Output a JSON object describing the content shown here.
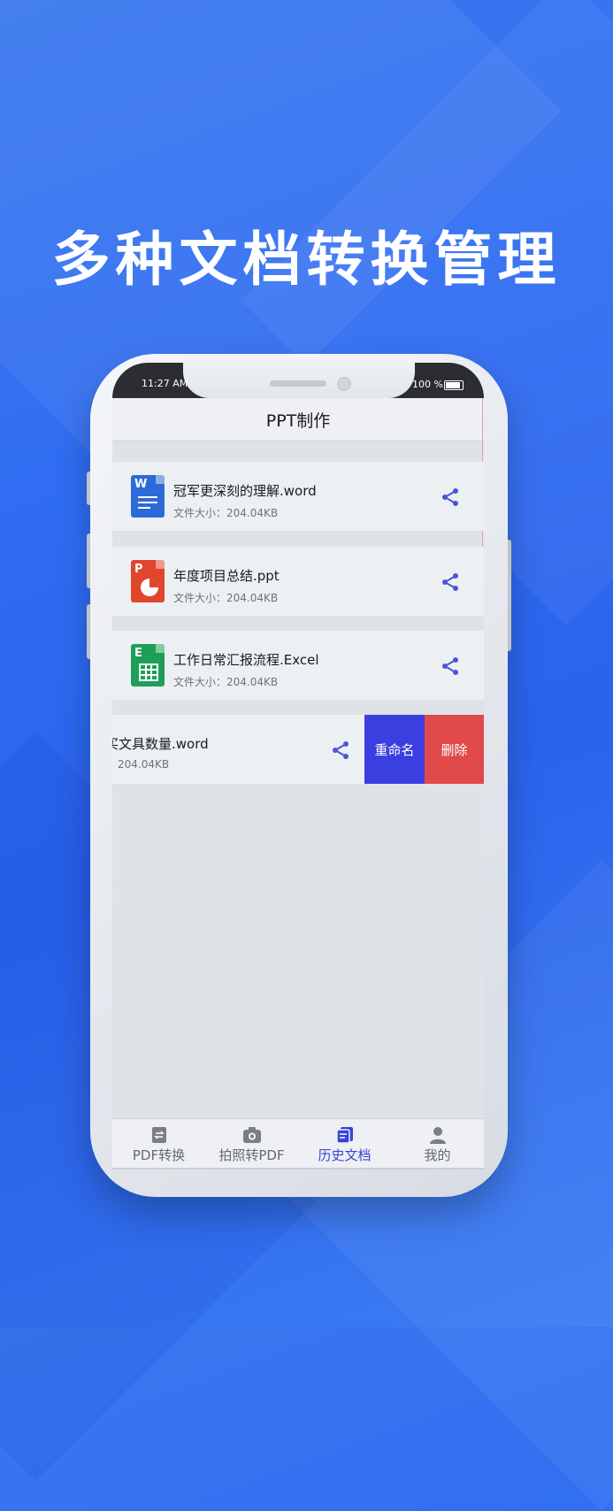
{
  "headline": "多种文档转换管理",
  "status_bar": {
    "time": "11:27 AM",
    "battery": "100 %"
  },
  "screen": {
    "title": "PPT制作",
    "files": [
      {
        "name": "冠军更深刻的理解.word",
        "size": "文件大小：204.04KB",
        "type": "word",
        "icon_letter": "W"
      },
      {
        "name": "年度项目总结.ppt",
        "size": "文件大小：204.04KB",
        "type": "ppt",
        "icon_letter": "P"
      },
      {
        "name": "工作日常汇报流程.Excel",
        "size": "文件大小：204.04KB",
        "type": "excel",
        "icon_letter": "E"
      },
      {
        "name": "买文具数量.word",
        "size": "204.04KB",
        "type": "word"
      }
    ],
    "swipe_actions": {
      "rename": "重命名",
      "delete": "删除"
    }
  },
  "tabs": [
    {
      "label": "PDF转换",
      "icon": "pdf-convert-icon",
      "active": false
    },
    {
      "label": "拍照转PDF",
      "icon": "camera-icon",
      "active": false
    },
    {
      "label": "历史文档",
      "icon": "history-doc-icon",
      "active": true
    },
    {
      "label": "我的",
      "icon": "user-icon",
      "active": false
    }
  ],
  "colors": {
    "background": "#2f6cf2",
    "word": "#2d6ad8",
    "ppt": "#e0462d",
    "excel": "#1f9e57",
    "rename": "#3b3fe0",
    "delete": "#e04a4a",
    "share": "#4a55d8",
    "active_tab": "#3a43d8"
  }
}
